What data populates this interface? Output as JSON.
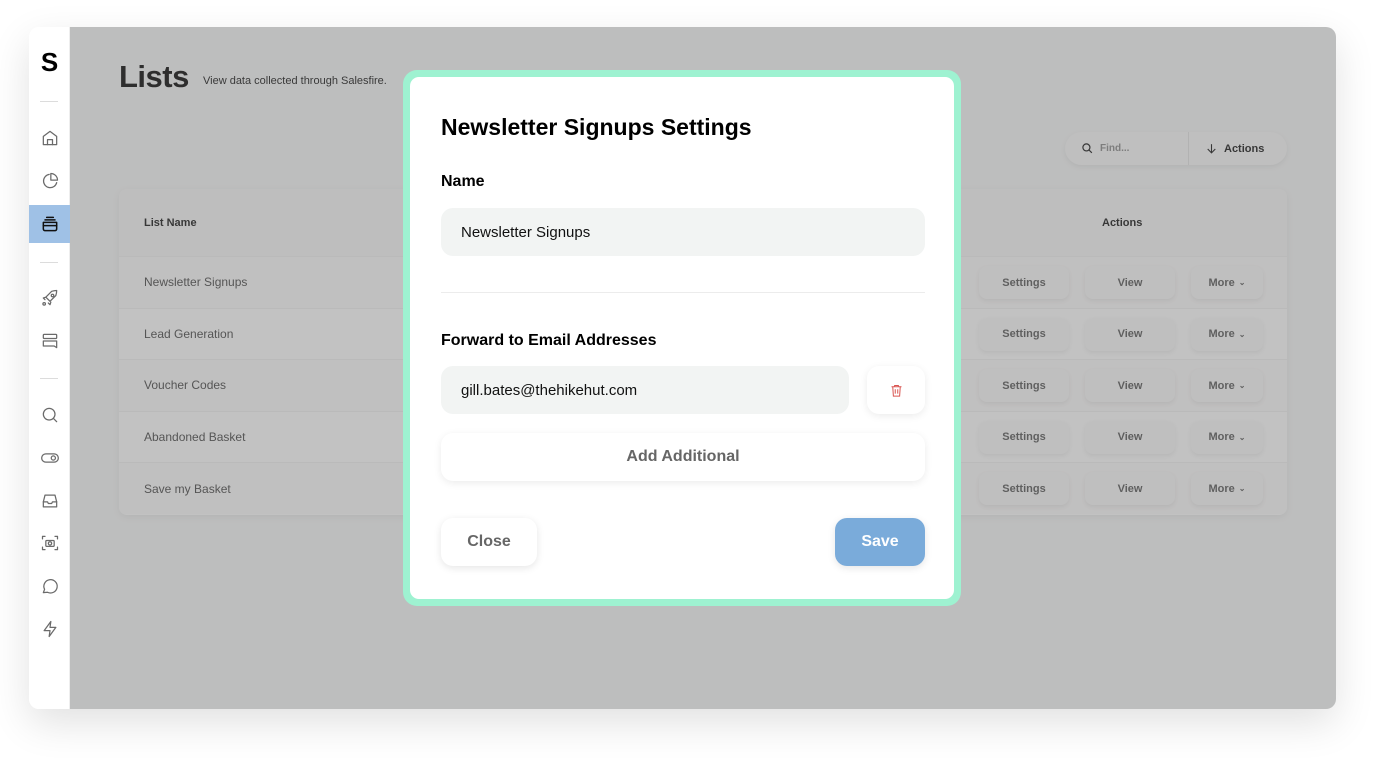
{
  "sidebar": {
    "logo": "S",
    "items": [
      {
        "name": "home",
        "active": false
      },
      {
        "name": "analytics",
        "active": false
      },
      {
        "name": "lists",
        "active": true
      },
      {
        "name": "campaigns",
        "active": false
      },
      {
        "name": "banners",
        "active": false
      },
      {
        "name": "search",
        "active": false
      },
      {
        "name": "toggles",
        "active": false
      },
      {
        "name": "inbox",
        "active": false
      },
      {
        "name": "capture",
        "active": false
      },
      {
        "name": "chat",
        "active": false
      },
      {
        "name": "automation",
        "active": false
      }
    ],
    "active_color": "#9fc1e6"
  },
  "page": {
    "title": "Lists",
    "subtitle": "View data collected through Salesfire."
  },
  "toolbar": {
    "find_placeholder": "Find...",
    "actions_label": "Actions"
  },
  "table": {
    "columns": [
      "List Name",
      "Actions"
    ],
    "rows": [
      {
        "name": "Newsletter Signups"
      },
      {
        "name": "Lead Generation"
      },
      {
        "name": "Voucher Codes"
      },
      {
        "name": "Abandoned Basket"
      },
      {
        "name": "Save my Basket"
      }
    ],
    "row_buttons": {
      "settings": "Settings",
      "view": "View",
      "more": "More",
      "more_chevron": "⌄"
    }
  },
  "modal": {
    "title": "Newsletter Signups Settings",
    "name_label": "Name",
    "name_value": "Newsletter Signups",
    "forward_label": "Forward to Email Addresses",
    "emails": [
      "gill.bates@thehikehut.com"
    ],
    "add_label": "Add Additional",
    "close_label": "Close",
    "save_label": "Save",
    "border_color": "#9ef2d1",
    "save_color": "#7aabda",
    "delete_color": "#d9534f"
  }
}
